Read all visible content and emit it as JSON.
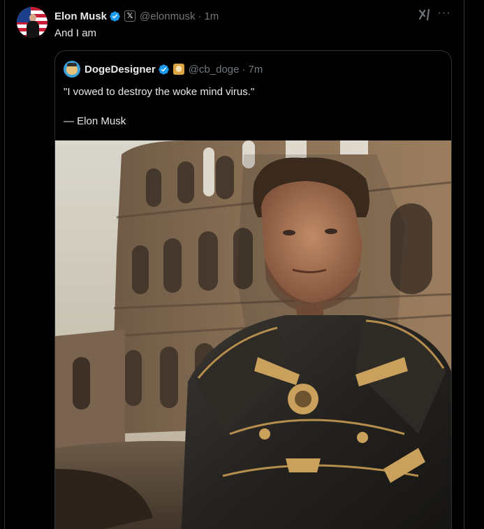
{
  "tweet": {
    "author_name": "Elon Musk",
    "author_handle": "@elonmusk",
    "separator": "·",
    "time": "1m",
    "text": "And I am",
    "x_badge": "𝕏",
    "more_icon_label": "···",
    "icons": [
      "verified-icon",
      "x-affiliate-badge-icon",
      "grok-icon",
      "more-icon"
    ]
  },
  "quote": {
    "author_name": "DogeDesigner",
    "author_handle": "@cb_doge",
    "separator": "·",
    "time": "7m",
    "text_line1": "\"I vowed to destroy the woke mind virus.\"",
    "attribution": "— Elon Musk",
    "icons": [
      "verified-icon",
      "doge-badge-icon"
    ]
  },
  "colors": {
    "background": "#000000",
    "text": "#e7e9ea",
    "secondary": "#71767b",
    "border": "#2f3336",
    "verified": "#1d9bf0"
  }
}
